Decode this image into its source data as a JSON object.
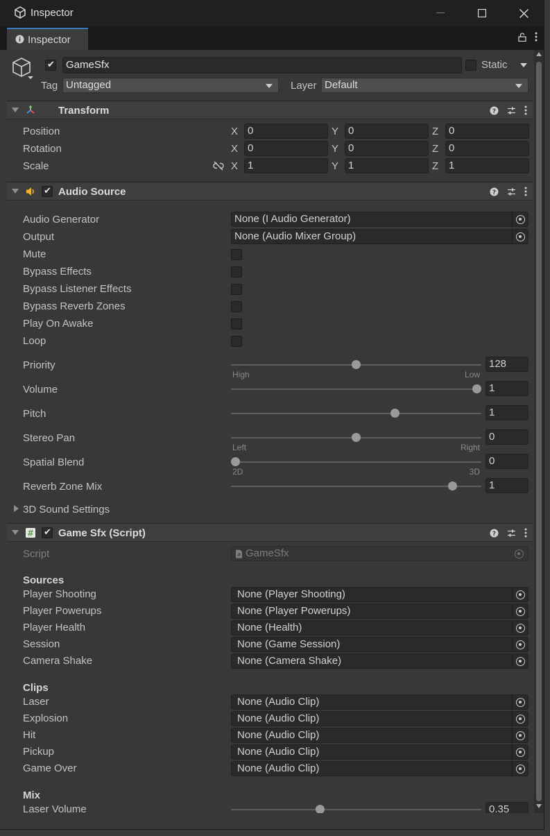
{
  "window": {
    "title": "Inspector"
  },
  "tab": {
    "label": "Inspector"
  },
  "object": {
    "name": "GameSfx",
    "active": true,
    "static_label": "Static",
    "tag_label": "Tag",
    "tag_value": "Untagged",
    "layer_label": "Layer",
    "layer_value": "Default"
  },
  "transform": {
    "title": "Transform",
    "rows": [
      {
        "label": "Position",
        "x": "0",
        "y": "0",
        "z": "0"
      },
      {
        "label": "Rotation",
        "x": "0",
        "y": "0",
        "z": "0"
      },
      {
        "label": "Scale",
        "x": "1",
        "y": "1",
        "z": "1"
      }
    ],
    "axis_labels": [
      "X",
      "Y",
      "Z"
    ]
  },
  "audio_source": {
    "title": "Audio Source",
    "audio_generator": {
      "label": "Audio Generator",
      "value": "None (I Audio Generator)"
    },
    "output": {
      "label": "Output",
      "value": "None (Audio Mixer Group)"
    },
    "toggles": [
      "Mute",
      "Bypass Effects",
      "Bypass Listener Effects",
      "Bypass Reverb Zones",
      "Play On Awake",
      "Loop"
    ],
    "sliders": [
      {
        "label": "Priority",
        "value": "128",
        "fraction": 0.5,
        "min_label": "High",
        "max_label": "Low"
      },
      {
        "label": "Volume",
        "value": "1",
        "fraction": 1.0,
        "min_label": "",
        "max_label": ""
      },
      {
        "label": "Pitch",
        "value": "1",
        "fraction": 0.66,
        "min_label": "",
        "max_label": ""
      },
      {
        "label": "Stereo Pan",
        "value": "0",
        "fraction": 0.5,
        "min_label": "Left",
        "max_label": "Right"
      },
      {
        "label": "Spatial Blend",
        "value": "0",
        "fraction": 0.0,
        "min_label": "2D",
        "max_label": "3D"
      },
      {
        "label": "Reverb Zone Mix",
        "value": "1",
        "fraction": 0.9,
        "min_label": "",
        "max_label": ""
      }
    ],
    "sound_settings_label": "3D Sound Settings"
  },
  "game_sfx": {
    "title": "Game Sfx (Script)",
    "script": {
      "label": "Script",
      "value": "GameSfx"
    },
    "sources_heading": "Sources",
    "sources": [
      {
        "label": "Player Shooting",
        "value": "None (Player Shooting)"
      },
      {
        "label": "Player Powerups",
        "value": "None (Player Powerups)"
      },
      {
        "label": "Player Health",
        "value": "None (Health)"
      },
      {
        "label": "Session",
        "value": "None (Game Session)"
      },
      {
        "label": "Camera Shake",
        "value": "None (Camera Shake)"
      }
    ],
    "clips_heading": "Clips",
    "clips": [
      {
        "label": "Laser",
        "value": "None (Audio Clip)"
      },
      {
        "label": "Explosion",
        "value": "None (Audio Clip)"
      },
      {
        "label": "Hit",
        "value": "None (Audio Clip)"
      },
      {
        "label": "Pickup",
        "value": "None (Audio Clip)"
      },
      {
        "label": "Game Over",
        "value": "None (Audio Clip)"
      }
    ],
    "mix_heading": "Mix",
    "mix": [
      {
        "label": "Laser Volume",
        "value": "0.35",
        "fraction": 0.35
      }
    ]
  },
  "colors": {
    "accent": "#3a79bb",
    "audio_icon": "#f1b52f",
    "script_icon": "#7fc46b"
  },
  "icons": [
    "unity-icon",
    "info-icon",
    "lock-icon",
    "kebab-icon",
    "cube-icon",
    "transform-icon",
    "speaker-icon",
    "script-icon",
    "help-icon",
    "preset-icon",
    "unlink-icon",
    "object-picker-icon"
  ]
}
